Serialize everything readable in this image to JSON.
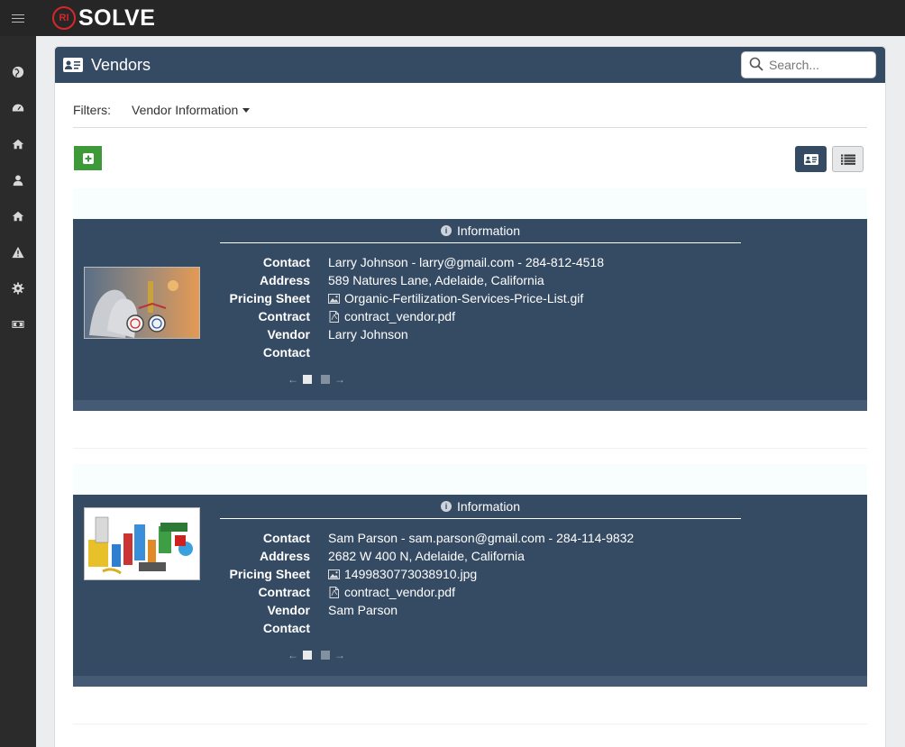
{
  "app": {
    "logo_text": "SOLVE",
    "logo_mark": "RI"
  },
  "sidebar": {
    "items": [
      {
        "icon": "globe-icon"
      },
      {
        "icon": "dashboard-icon"
      },
      {
        "icon": "home-icon"
      },
      {
        "icon": "user-icon"
      },
      {
        "icon": "home-icon"
      },
      {
        "icon": "warning-icon"
      },
      {
        "icon": "gear-icon"
      },
      {
        "icon": "money-icon"
      }
    ]
  },
  "header": {
    "title": "Vendors",
    "search_placeholder": "Search..."
  },
  "filters": {
    "label": "Filters:",
    "selected": "Vendor Information"
  },
  "vendors": [
    {
      "info_title": "Information",
      "rows": [
        {
          "key": "Contact",
          "value": "Larry Johnson - larry@gmail.com - 284-812-4518",
          "icon": ""
        },
        {
          "key": "Address",
          "value": "589 Natures Lane, Adelaide, California",
          "icon": ""
        },
        {
          "key": "Pricing Sheet",
          "value": "Organic-Fertilization-Services-Price-List.gif",
          "icon": "image-file-icon"
        },
        {
          "key": "Contract",
          "value": "contract_vendor.pdf",
          "icon": "pdf-file-icon"
        },
        {
          "key": "Vendor",
          "value": "Larry Johnson",
          "icon": ""
        },
        {
          "key": "Contact",
          "value": "",
          "icon": ""
        }
      ]
    },
    {
      "info_title": "Information",
      "rows": [
        {
          "key": "Contact",
          "value": "Sam Parson - sam.parson@gmail.com - 284-114-9832",
          "icon": ""
        },
        {
          "key": "Address",
          "value": "2682 W 400 N, Adelaide, California",
          "icon": ""
        },
        {
          "key": "Pricing Sheet",
          "value": "1499830773038910.jpg",
          "icon": "image-file-icon"
        },
        {
          "key": "Contract",
          "value": "contract_vendor.pdf",
          "icon": "pdf-file-icon"
        },
        {
          "key": "Vendor",
          "value": "Sam Parson",
          "icon": ""
        },
        {
          "key": "Contact",
          "value": "",
          "icon": ""
        }
      ]
    }
  ],
  "colors": {
    "header_bg": "#354a63",
    "topbar_bg": "#262626",
    "sidebar_bg": "#2b2b2b",
    "add_green": "#3e9a39",
    "logo_red": "#d8262a"
  }
}
